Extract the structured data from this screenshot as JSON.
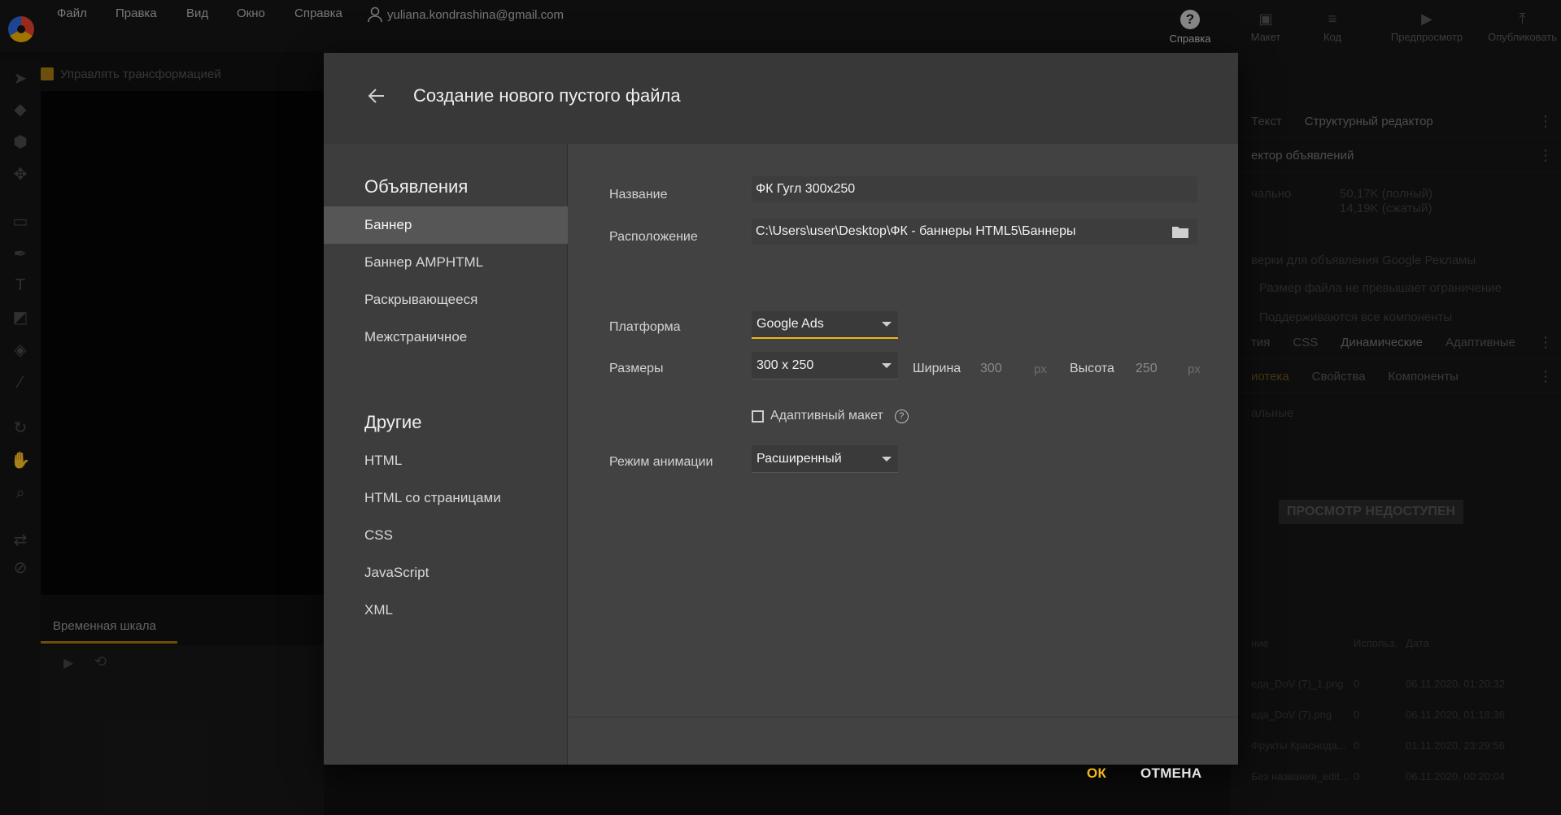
{
  "menubar": {
    "items": [
      "Файл",
      "Правка",
      "Вид",
      "Окно",
      "Справка"
    ],
    "user_email": "yuliana.kondrashina@gmail.com"
  },
  "toolbar": {
    "help": "Справка",
    "layout": "Макет",
    "code": "Код",
    "preview": "Предпросмотр",
    "publish": "Опубликовать"
  },
  "transform": {
    "label": "Управлять трансформацией"
  },
  "timeline": {
    "tab": "Временная шкала"
  },
  "right_panel": {
    "tabs1": [
      "Текст",
      "Структурный редактор"
    ],
    "ad_inspector": "ектор объявлений",
    "size_caption": "чально",
    "size_full": "50,17K (полный)",
    "size_compressed": "14,19K (сжатый)",
    "checks_title": "верки для объявления Google Рекламы",
    "check1": "Размер файла не превышает ограничение",
    "check2": "Поддерживаются все компоненты",
    "tabs2": [
      "тия",
      "CSS",
      "Динамические",
      "Адаптивные"
    ],
    "tabs3": [
      "иотека",
      "Свойства",
      "Компоненты"
    ],
    "filter": "альные",
    "preview_na": "ПРОСМОТР НЕДОСТУПЕН",
    "columns": [
      "ние",
      "Использ.",
      "Дата"
    ],
    "rows": [
      {
        "name": "еда_DoV (7)_1.png",
        "uses": "0",
        "date": "06.11.2020, 01:20:32"
      },
      {
        "name": "еда_DoV (7).png",
        "uses": "0",
        "date": "06.11.2020, 01:18:36"
      },
      {
        "name": "Фрукты Краснода...",
        "uses": "0",
        "date": "01.11.2020, 23:29:56"
      },
      {
        "name": "Без названия_edit...",
        "uses": "0",
        "date": "06.11.2020, 00:20:04"
      }
    ]
  },
  "dialog": {
    "title": "Создание нового пустого файла",
    "category_ads": "Объявления",
    "ads_items": [
      "Баннер",
      "Баннер AMPHTML",
      "Раскрывающееся",
      "Межстраничное"
    ],
    "selected_index": 0,
    "category_other": "Другие",
    "other_items": [
      "HTML",
      "HTML со страницами",
      "CSS",
      "JavaScript",
      "XML"
    ],
    "form": {
      "name_label": "Название",
      "name_value": "ФК Гугл 300x250",
      "location_label": "Расположение",
      "location_value": "C:\\Users\\user\\Desktop\\ФК - баннеры HTML5\\Баннеры",
      "platform_label": "Платформа",
      "platform_value": "Google Ads",
      "sizes_label": "Размеры",
      "sizes_value": "300 x 250",
      "width_label": "Ширина",
      "width_value": "300",
      "height_label": "Высота",
      "height_value": "250",
      "unit": "px",
      "responsive_label": "Адаптивный макет",
      "responsive_checked": false,
      "anim_label": "Режим анимации",
      "anim_value": "Расширенный"
    },
    "ok": "ОК",
    "cancel": "ОТМЕНА"
  },
  "colors": {
    "accent": "#f2b51b",
    "dialog_bg": "#424242",
    "header_bg": "#383838"
  }
}
